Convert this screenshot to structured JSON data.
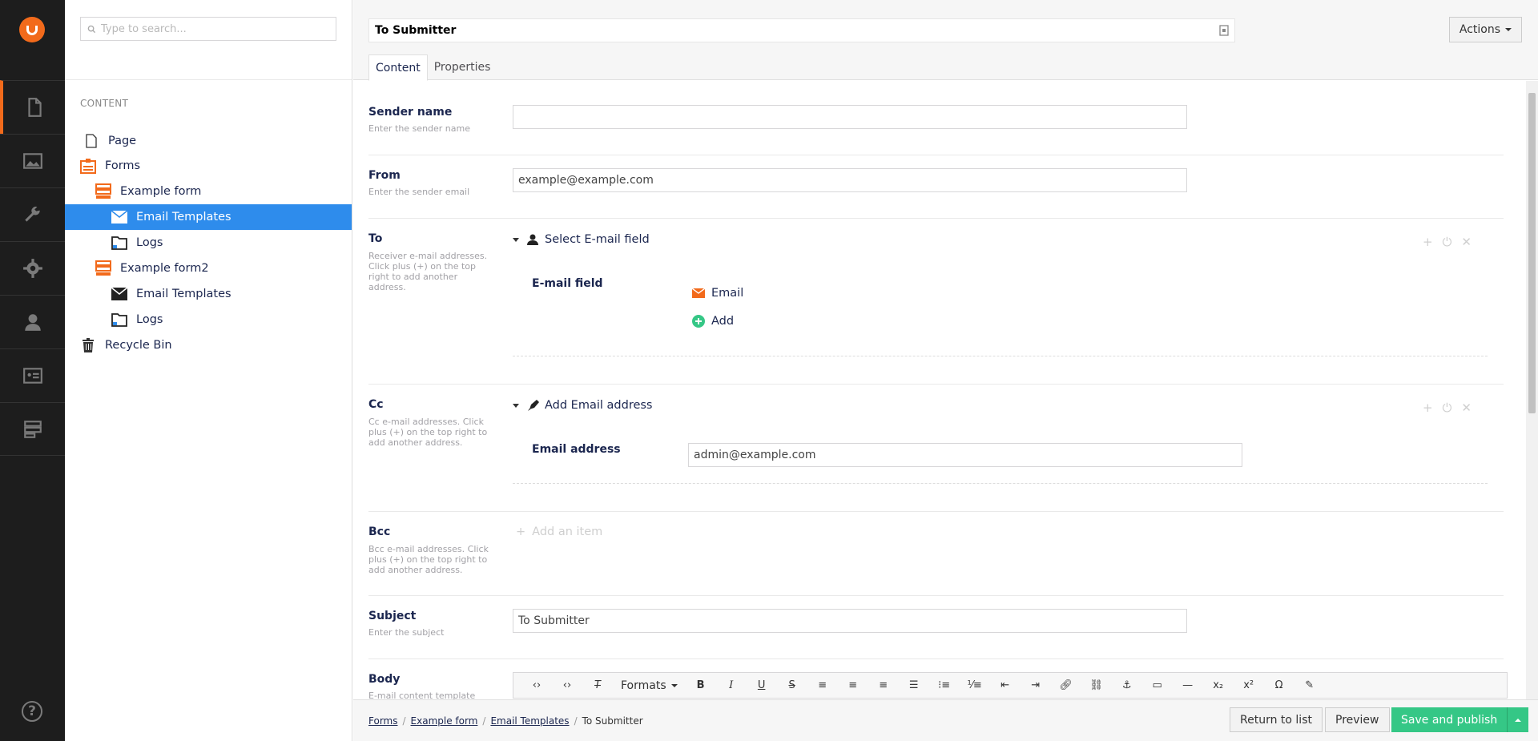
{
  "search": {
    "placeholder": "Type to search..."
  },
  "tree": {
    "root_label": "CONTENT",
    "nodes": [
      {
        "label": "Page",
        "icon": "page-icon"
      },
      {
        "label": "Forms",
        "icon": "forms-icon"
      },
      {
        "label": "Example form",
        "icon": "form-icon"
      },
      {
        "label": "Email Templates",
        "icon": "envelope-icon"
      },
      {
        "label": "Logs",
        "icon": "folder-icon"
      },
      {
        "label": "Example form2",
        "icon": "form-icon"
      },
      {
        "label": "Email Templates",
        "icon": "envelope-icon"
      },
      {
        "label": "Logs",
        "icon": "folder-icon"
      },
      {
        "label": "Recycle Bin",
        "icon": "trash-icon"
      }
    ]
  },
  "header": {
    "node_name": "To Submitter",
    "actions_label": "Actions",
    "tabs": [
      "Content",
      "Properties"
    ]
  },
  "props": {
    "sender_name": {
      "label": "Sender name",
      "desc": "Enter the sender name",
      "value": ""
    },
    "from": {
      "label": "From",
      "desc": "Enter the sender email",
      "value": "example@example.com"
    },
    "to": {
      "label": "To",
      "desc": "Receiver e-mail addresses. Click plus (+) on the top right to add another address.",
      "item_title": "Select E-mail field",
      "sub_label": "E-mail field",
      "selected": "Email",
      "add_label": "Add"
    },
    "cc": {
      "label": "Cc",
      "desc": "Cc e-mail addresses. Click plus (+) on the top right to add another address.",
      "item_title": "Add Email address",
      "sub_label": "Email address",
      "value": "admin@example.com"
    },
    "bcc": {
      "label": "Bcc",
      "desc": "Bcc e-mail addresses. Click plus (+) on the top right to add another address.",
      "add_item": "Add an item"
    },
    "subject": {
      "label": "Subject",
      "desc": "Enter the subject",
      "value": "To Submitter"
    },
    "body": {
      "label": "Body",
      "desc": "E-mail content template",
      "formats_label": "Formats"
    }
  },
  "footer": {
    "breadcrumbs": [
      "Forms",
      "Example form",
      "Email Templates",
      "To Submitter"
    ],
    "return_label": "Return to list",
    "preview_label": "Preview",
    "publish_label": "Save and publish"
  },
  "colors": {
    "accent": "#f26a1b",
    "selected": "#2e8cec",
    "publish": "#35c786",
    "sidebar": "#1d1d1d"
  }
}
